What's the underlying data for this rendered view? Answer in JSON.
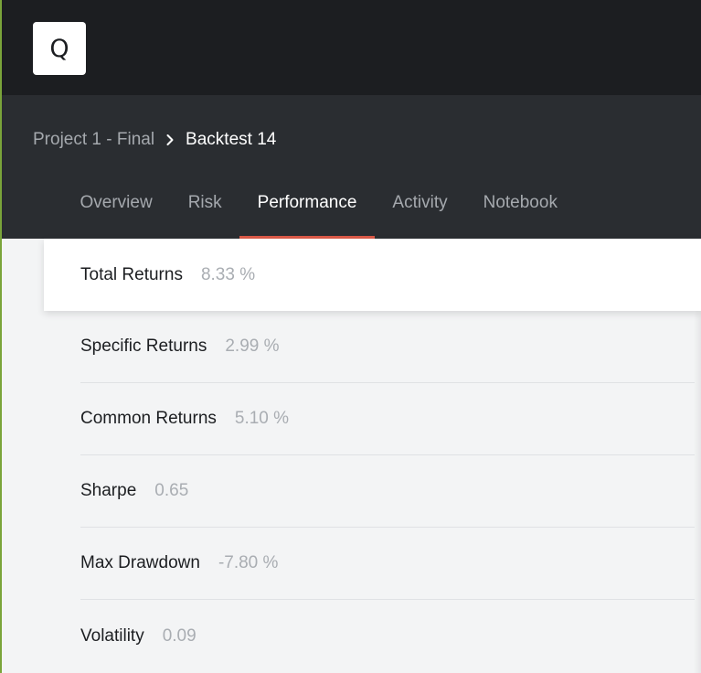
{
  "header": {
    "logo_letter": "Q"
  },
  "breadcrumb": {
    "parent": "Project 1 - Final",
    "current": "Backtest 14"
  },
  "tabs": [
    {
      "label": "Overview",
      "active": false
    },
    {
      "label": "Risk",
      "active": false
    },
    {
      "label": "Performance",
      "active": true
    },
    {
      "label": "Activity",
      "active": false
    },
    {
      "label": "Notebook",
      "active": false
    }
  ],
  "metrics": [
    {
      "label": "Total Returns",
      "value": "8.33 %",
      "selected": true
    },
    {
      "label": "Specific Returns",
      "value": "2.99 %",
      "selected": false
    },
    {
      "label": "Common Returns",
      "value": "5.10 %",
      "selected": false
    },
    {
      "label": "Sharpe",
      "value": "0.65",
      "selected": false
    },
    {
      "label": "Max Drawdown",
      "value": "-7.80 %",
      "selected": false
    },
    {
      "label": "Volatility",
      "value": "0.09",
      "selected": false
    }
  ],
  "colors": {
    "topbar": "#1c1e21",
    "subheader": "#2a2d31",
    "active_tab_underline": "#dc5a48",
    "left_accent": "#7aa43a",
    "content_background": "#f3f4f5"
  },
  "icons": {
    "logo": "logo-q-icon",
    "breadcrumb_separator": "chevron-right-icon"
  }
}
